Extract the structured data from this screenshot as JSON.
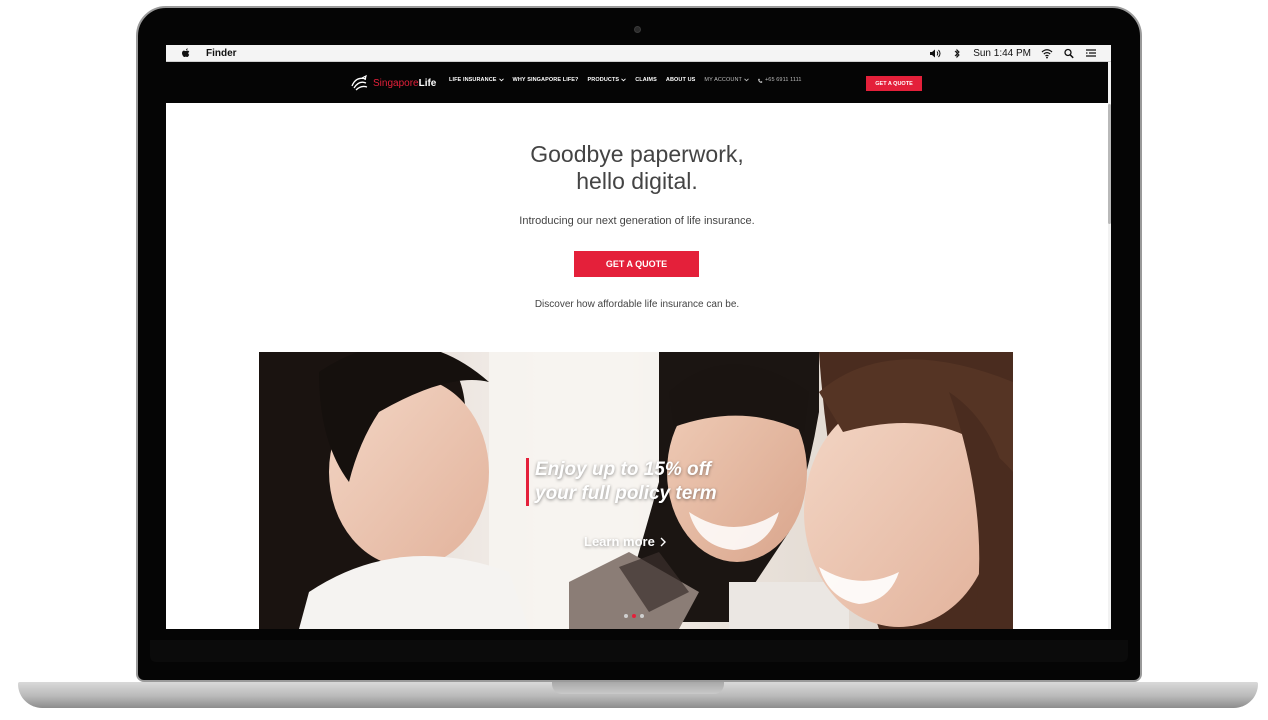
{
  "menubar": {
    "app_name": "Finder",
    "clock": "Sun 1:44 PM",
    "icons": [
      "apple-icon",
      "volume-icon",
      "bluetooth-icon",
      "wifi-icon",
      "search-icon",
      "list-icon"
    ]
  },
  "site": {
    "logo_prefix": "Singapore",
    "logo_suffix": "Life",
    "nav": [
      {
        "label": "LIFE INSURANCE",
        "dropdown": true
      },
      {
        "label": "WHY SINGAPORE LIFE?",
        "dropdown": false
      },
      {
        "label": "PRODUCTS",
        "dropdown": true
      },
      {
        "label": "CLAIMS",
        "dropdown": false
      },
      {
        "label": "ABOUT US",
        "dropdown": false
      },
      {
        "label": "MY ACCOUNT",
        "dropdown": true
      },
      {
        "label": "+65 6911 1111",
        "dropdown": false
      }
    ],
    "nav_cta": "GET A QUOTE"
  },
  "hero": {
    "title_line1": "Goodbye paperwork,",
    "title_line2": "hello digital.",
    "subtitle": "Introducing our next generation of life insurance.",
    "button": "GET A QUOTE",
    "note": "Discover how affordable life insurance can be."
  },
  "banner": {
    "promo_line1": "Enjoy up to 15% off",
    "promo_line2": "your full policy term",
    "link": "Learn more",
    "slide_count": 3,
    "active_slide": 1
  },
  "colors": {
    "brand_red": "#e4203a",
    "nav_bg": "#050505",
    "text": "#444444"
  }
}
